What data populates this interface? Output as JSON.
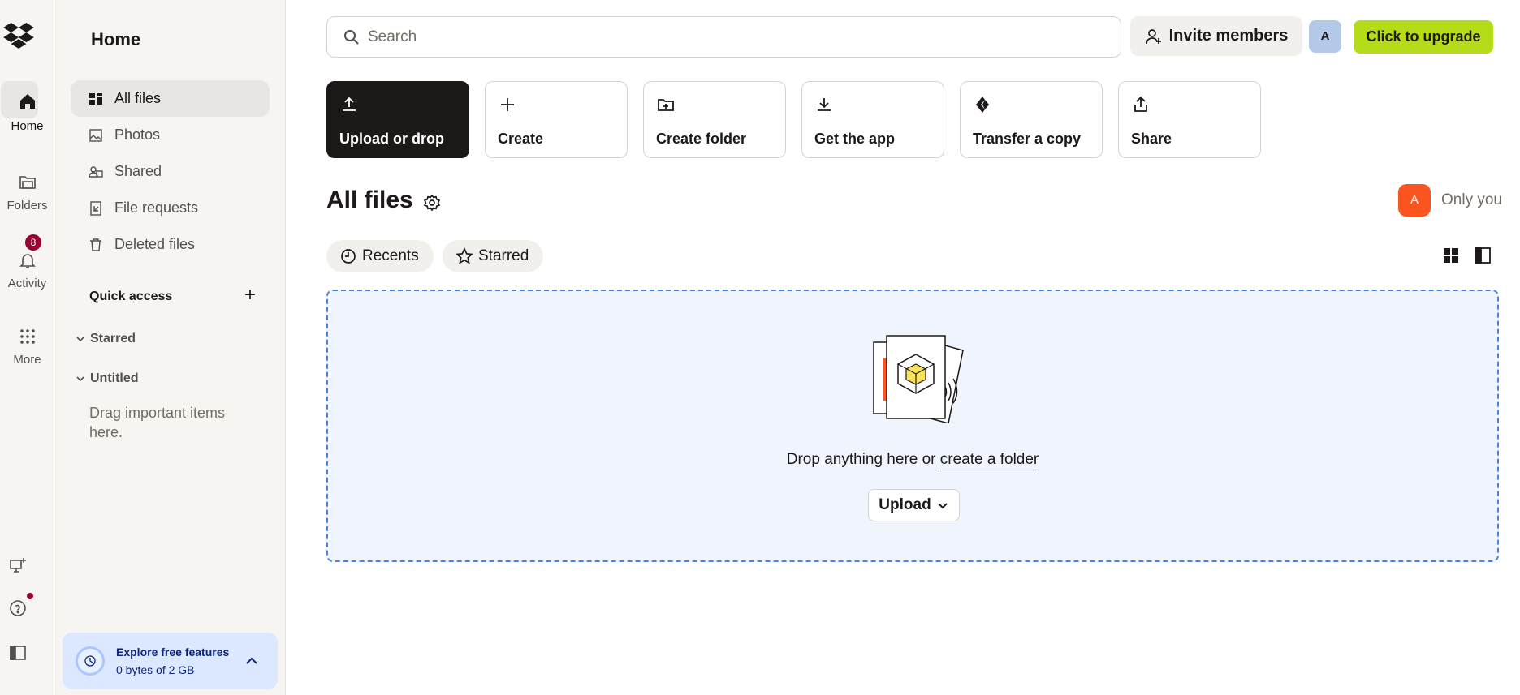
{
  "rail": {
    "items": [
      {
        "label": "Home",
        "icon": "home-icon"
      },
      {
        "label": "Folders",
        "icon": "folder-icon"
      },
      {
        "label": "Activity",
        "icon": "bell-icon",
        "badge": "8"
      },
      {
        "label": "More",
        "icon": "grid-icon"
      }
    ],
    "bottom_icons": [
      "desktop-add-icon",
      "help-icon",
      "sidebar-toggle-icon"
    ]
  },
  "sidebar": {
    "title": "Home",
    "items": [
      {
        "label": "All files",
        "icon": "all-files-icon",
        "active": true
      },
      {
        "label": "Photos",
        "icon": "photo-icon"
      },
      {
        "label": "Shared",
        "icon": "shared-icon"
      },
      {
        "label": "File requests",
        "icon": "file-request-icon"
      },
      {
        "label": "Deleted files",
        "icon": "trash-icon"
      }
    ],
    "quick_access": "Quick access",
    "groups": [
      "Starred",
      "Untitled"
    ],
    "hint": "Drag important items here.",
    "explore": {
      "title": "Explore free features",
      "usage": "0 bytes of 2 GB"
    }
  },
  "header": {
    "search_placeholder": "Search",
    "invite_label": "Invite members",
    "avatar_initial": "A",
    "upgrade_label": "Click to upgrade"
  },
  "actions": [
    {
      "label": "Upload or drop",
      "icon": "upload-icon"
    },
    {
      "label": "Create",
      "icon": "plus-icon"
    },
    {
      "label": "Create folder",
      "icon": "folder-plus-icon"
    },
    {
      "label": "Get the app",
      "icon": "download-icon"
    },
    {
      "label": "Transfer a copy",
      "icon": "transfer-icon"
    },
    {
      "label": "Share",
      "icon": "share-icon"
    }
  ],
  "main": {
    "title": "All files",
    "owner_initial": "A",
    "owner_text": "Only you",
    "chips": [
      {
        "label": "Recents",
        "icon": "clock-icon"
      },
      {
        "label": "Starred",
        "icon": "star-icon"
      }
    ],
    "drop": {
      "message": "Drop anything here or",
      "link": "create a folder",
      "upload_label": "Upload"
    }
  },
  "colors": {
    "upgrade": "#b4dc19",
    "badge": "#9b0032",
    "owner_avatar": "#fa551e",
    "drop_border": "#4a86d8"
  }
}
